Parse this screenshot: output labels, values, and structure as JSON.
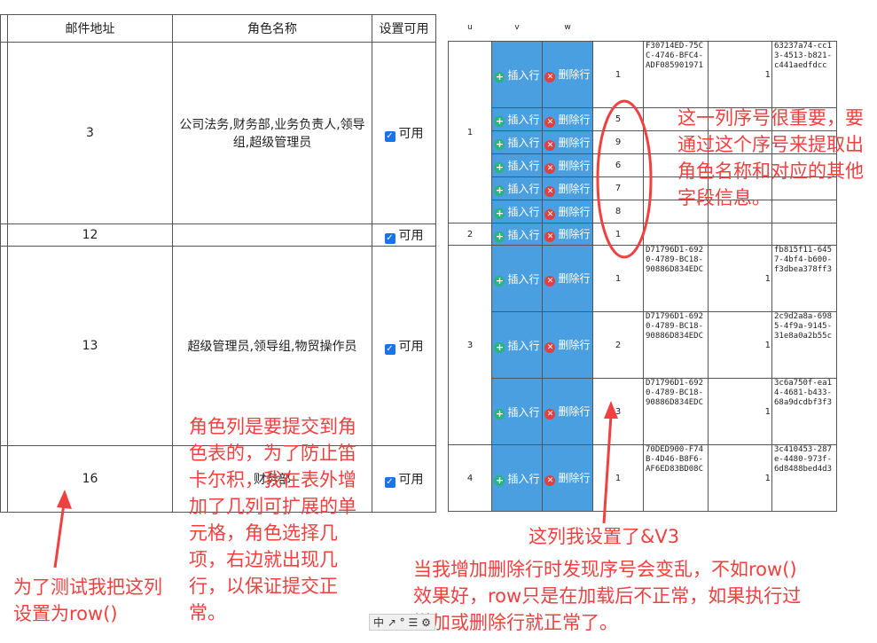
{
  "left_table": {
    "headers": [
      "邮件地址",
      "角色名称",
      "设置可用"
    ],
    "rows": [
      {
        "email": "3",
        "roles": "公司法务,财务部,业务负责人,领导组,超级管理员",
        "status": "可用"
      },
      {
        "email": "12",
        "roles": "",
        "status": "可用"
      },
      {
        "email": "13",
        "roles": "超级管理员,领导组,物贸操作员",
        "status": "可用"
      },
      {
        "email": "16",
        "roles": "财务部",
        "status": "可用"
      }
    ]
  },
  "right_table": {
    "headers": [
      "u",
      "v",
      "w"
    ],
    "insert_label": "插入行",
    "delete_label": "删除行",
    "groups": [
      {
        "u": "1",
        "rows": [
          {
            "seq": "1",
            "guid": "F30714ED-75CC-4746-BFC4-ADF085901971",
            "one": "1",
            "id": "63237a74-cc13-4513-b821-c441aedfdcc"
          },
          {
            "seq": "5"
          },
          {
            "seq": "9"
          },
          {
            "seq": "6"
          },
          {
            "seq": "7"
          },
          {
            "seq": "8"
          }
        ]
      },
      {
        "u": "2",
        "rows": [
          {
            "seq": "1"
          }
        ]
      },
      {
        "u": "3",
        "rows": [
          {
            "seq": "1",
            "guid": "D71796D1-6920-4789-BC18-90886D834EDC",
            "one": "1",
            "id": "fb815f11-6457-4bf4-b600-f3dbea378ff3"
          },
          {
            "seq": "2",
            "guid": "D71796D1-6920-4789-BC18-90886D834EDC",
            "one": "1",
            "id": "2c9d2a8a-6985-4f9a-9145-31e8a0a2b55c"
          },
          {
            "seq": "3",
            "guid": "D71796D1-6920-4789-BC18-90886D834EDC",
            "one": "1",
            "id": "3c6a750f-ea14-4681-b433-68a9dcdbf3f3"
          }
        ]
      },
      {
        "u": "4",
        "rows": [
          {
            "seq": "1",
            "guid": "70DED900-F74B-4D46-B8F6-AF6ED83BD08C",
            "one": "1",
            "id": "3c410453-287e-4480-973f-6d8488bed4d3"
          }
        ]
      }
    ]
  },
  "annotations": {
    "seq_note": "这一列序号很重要，要通过这个序号来提取出角色名称和对应的其他字段信息。",
    "role_note": "角色列是要提交到角色表的，为了防止笛卡尔积，我在表外增加了几列可扩展的单元格，角色选择几项，右边就出现几行，以保证提交正常。",
    "test_note": "为了测试我把这列设置为row()",
    "v3_note": "这列我设置了&V3",
    "bottom_note": "当我增加删除行时发现序号会变乱，不如row()效果好，row只是在加载后不正常，如果执行过增加或删除行就正常了。"
  },
  "status_bar": "中 ↗ ° ☰ ⚙",
  "colors": {
    "accent": "#f04040",
    "button": "#4a9fe0",
    "plus": "#2ab37a",
    "delete": "#e04040",
    "checkbox": "#1a73e8"
  },
  "icons": [
    "plus-icon",
    "delete-icon",
    "checkbox-icon"
  ]
}
